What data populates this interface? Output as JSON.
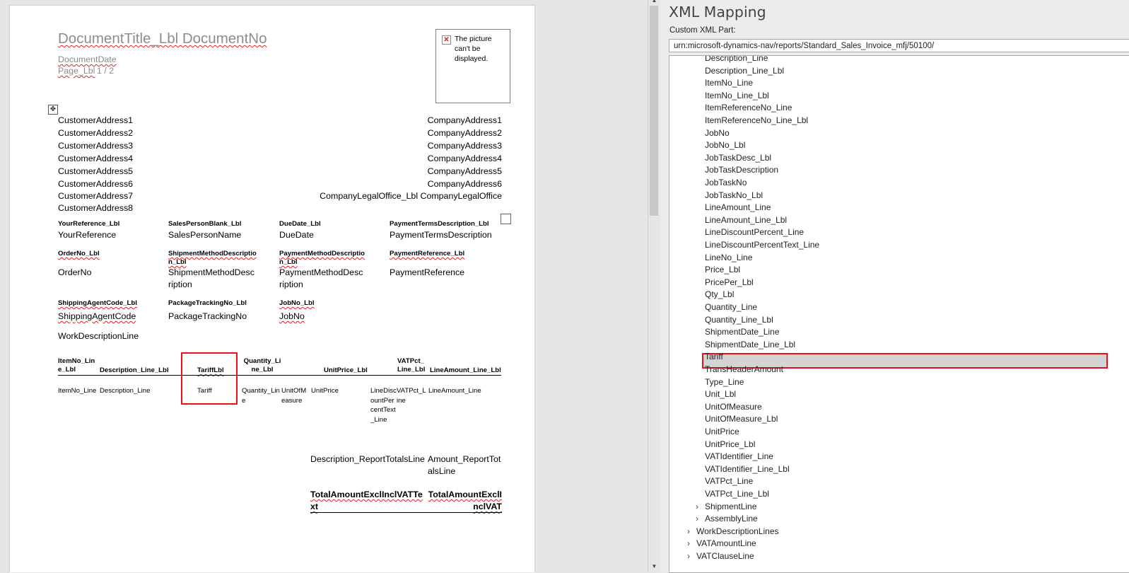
{
  "document": {
    "title": "DocumentTitle_Lbl DocumentNo",
    "date": "DocumentDate",
    "page_label": "Page_Lbl",
    "page_number": "1 / 2",
    "picture_placeholder": "The picture can't be displayed.",
    "customer_address": [
      "CustomerAddress1",
      "CustomerAddress2",
      "CustomerAddress3",
      "CustomerAddress4",
      "CustomerAddress5",
      "CustomerAddress6",
      "CustomerAddress7",
      "CustomerAddress8"
    ],
    "company_address": [
      "CompanyAddress1",
      "CompanyAddress2",
      "CompanyAddress3",
      "CompanyAddress4",
      "CompanyAddress5",
      "CompanyAddress6",
      "CompanyLegalOffice_Lbl CompanyLegalOffice"
    ],
    "header_rows": [
      {
        "labels": [
          "YourReference_Lbl",
          "SalesPersonBlank_Lbl",
          "DueDate_Lbl",
          "PaymentTermsDescription_Lbl"
        ],
        "values": [
          "YourReference",
          "SalesPersonName",
          "DueDate",
          "PaymentTermsDescription"
        ]
      },
      {
        "labels": [
          "OrderNo_Lbl",
          "ShipmentMethodDescription_Lbl",
          "PaymentMethodDescription_Lbl",
          "PaymentReference_Lbl"
        ],
        "values": [
          "OrderNo",
          "ShipmentMethodDescription",
          "PaymentMethodDescription",
          "PaymentReference"
        ]
      },
      {
        "labels": [
          "ShippingAgentCode_Lbl",
          "PackageTrackingNo_Lbl",
          "JobNo_Lbl"
        ],
        "values": [
          "ShippingAgentCode",
          "PackageTrackingNo",
          "JobNo"
        ]
      }
    ],
    "work_description": "WorkDescriptionLine",
    "line_headers": [
      "ItemNo_Line_Lbl",
      "Description_Line_Lbl",
      "TariffLbl",
      "Quantity_Line_Lbl",
      "UnitPrice_Lbl",
      "VATPct_Line_Lbl",
      "LineAmount_Line_Lbl"
    ],
    "line_values": [
      "ItemNo_Line",
      "Description_Line",
      "Tariff",
      "Quantity_Line",
      "UnitOfMeasure",
      "UnitPrice",
      "LineDiscountPercentText_Line",
      "VATPct_Line",
      "LineAmount_Line"
    ],
    "totals": {
      "description": "Description_ReportTotalsLine",
      "amount": "Amount_ReportTotalsLine",
      "total_label": "TotalAmountExclInclVATText",
      "total_value": "TotalAmountExclInclVAT"
    }
  },
  "xml_mapping": {
    "title": "XML Mapping",
    "custom_part_label": "Custom XML Part:",
    "custom_part_value": "urn:microsoft-dynamics-nav/reports/Standard_Sales_Invoice_mfj/50100/",
    "tree_items": [
      "Description_Line",
      "Description_Line_Lbl",
      "ItemNo_Line",
      "ItemNo_Line_Lbl",
      "ItemReferenceNo_Line",
      "ItemReferenceNo_Line_Lbl",
      "JobNo",
      "JobNo_Lbl",
      "JobTaskDesc_Lbl",
      "JobTaskDescription",
      "JobTaskNo",
      "JobTaskNo_Lbl",
      "LineAmount_Line",
      "LineAmount_Line_Lbl",
      "LineDiscountPercent_Line",
      "LineDiscountPercentText_Line",
      "LineNo_Line",
      "Price_Lbl",
      "PricePer_Lbl",
      "Qty_Lbl",
      "Quantity_Line",
      "Quantity_Line_Lbl",
      "ShipmentDate_Line",
      "ShipmentDate_Line_Lbl",
      "Tariff",
      "TransHeaderAmount",
      "Type_Line",
      "Unit_Lbl",
      "UnitOfMeasure",
      "UnitOfMeasure_Lbl",
      "UnitPrice",
      "UnitPrice_Lbl",
      "VATIdentifier_Line",
      "VATIdentifier_Line_Lbl",
      "VATPct_Line",
      "VATPct_Line_Lbl"
    ],
    "selected_item": "Tariff",
    "collapsed_children": [
      "ShipmentLine",
      "AssemblyLine"
    ],
    "collapsed_siblings": [
      "WorkDescriptionLines",
      "VATAmountLine",
      "VATClauseLine"
    ]
  },
  "icons": {
    "move_handle": "move-handle-icon",
    "broken_picture": "broken-image-icon",
    "expand": "chevron-right-icon"
  },
  "colors": {
    "highlight": "#e8101c",
    "selected_row": "#d4d4d4"
  }
}
